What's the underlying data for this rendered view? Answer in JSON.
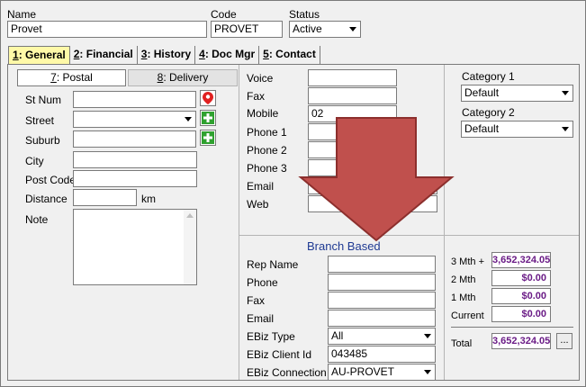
{
  "header": {
    "name_label": "Name",
    "name_value": "Provet",
    "code_label": "Code",
    "code_value": "PROVET",
    "status_label": "Status",
    "status_value": "Active"
  },
  "tabs": [
    {
      "key": "1",
      "label": ": General"
    },
    {
      "key": "2",
      "label": ": Financial"
    },
    {
      "key": "3",
      "label": ": History"
    },
    {
      "key": "4",
      "label": ": Doc Mgr"
    },
    {
      "key": "5",
      "label": ": Contact"
    }
  ],
  "address": {
    "subtabs": [
      {
        "key": "7",
        "label": ": Postal"
      },
      {
        "key": "8",
        "label": ": Delivery"
      }
    ],
    "st_num_label": "St Num",
    "street_label": "Street",
    "suburb_label": "Suburb",
    "city_label": "City",
    "post_code_label": "Post Code",
    "distance_label": "Distance",
    "distance_unit": "km",
    "note_label": "Note"
  },
  "contact": {
    "voice_label": "Voice",
    "fax_label": "Fax",
    "mobile_label": "Mobile",
    "mobile_value": "02",
    "phone1_label": "Phone 1",
    "phone2_label": "Phone 2",
    "phone3_label": "Phone 3",
    "email_label": "Email",
    "web_label": "Web"
  },
  "categories": {
    "cat1_label": "Category 1",
    "cat1_value": "Default",
    "cat2_label": "Category 2",
    "cat2_value": "Default"
  },
  "branch": {
    "title": "Branch Based",
    "rep_name_label": "Rep Name",
    "phone_label": "Phone",
    "fax_label": "Fax",
    "email_label": "Email",
    "ebiz_type_label": "EBiz Type",
    "ebiz_type_value": "All",
    "ebiz_client_id_label": "EBiz Client Id",
    "ebiz_client_id_value": "043485",
    "ebiz_connection_label": "EBiz Connection",
    "ebiz_connection_value": "AU-PROVET"
  },
  "aging": {
    "m3_label": "3 Mth +",
    "m3_value": "3,652,324.05",
    "m2_label": "2 Mth",
    "m2_value": "$0.00",
    "m1_label": "1 Mth",
    "m1_value": "$0.00",
    "current_label": "Current",
    "current_value": "$0.00",
    "total_label": "Total",
    "total_value": "3,652,324.05",
    "ellipsis_label": "..."
  },
  "colors": {
    "active_tab": "#fff9a8",
    "overlay_arrow": "#c0504d",
    "money_text": "#6a1b86",
    "branch_title": "#1f3a93"
  },
  "overlay": {
    "icon": "down-arrow-annotation"
  }
}
